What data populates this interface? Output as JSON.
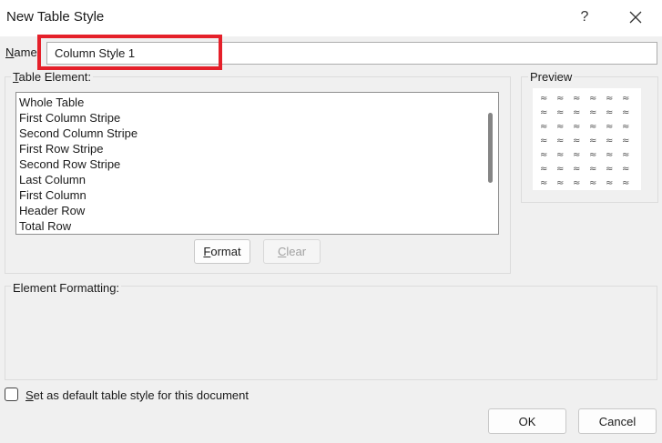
{
  "window": {
    "title": "New Table Style",
    "help_glyph": "?",
    "close_icon": "close-icon"
  },
  "name_field": {
    "label_accel": "N",
    "label_rest": "ame",
    "value": "Column Style 1"
  },
  "table_element": {
    "label_accel": "T",
    "label_rest": "able Element:",
    "items": [
      "Whole Table",
      "First Column Stripe",
      "Second Column Stripe",
      "First Row Stripe",
      "Second Row Stripe",
      "Last Column",
      "First Column",
      "Header Row",
      "Total Row"
    ],
    "format_accel": "F",
    "format_rest": "ormat",
    "clear_accel": "C",
    "clear_rest": "lear"
  },
  "preview": {
    "label": "Preview",
    "cell_glyph": "≈",
    "rows": 7,
    "cols": 6
  },
  "element_formatting": {
    "label": "Element Formatting:"
  },
  "default_checkbox": {
    "label_accel": "S",
    "label_rest": "et as default table style for this document",
    "checked": false
  },
  "buttons": {
    "ok": "OK",
    "cancel": "Cancel"
  },
  "colors": {
    "highlight": "#e5202a",
    "dialog_bg": "#f0f0f0"
  }
}
